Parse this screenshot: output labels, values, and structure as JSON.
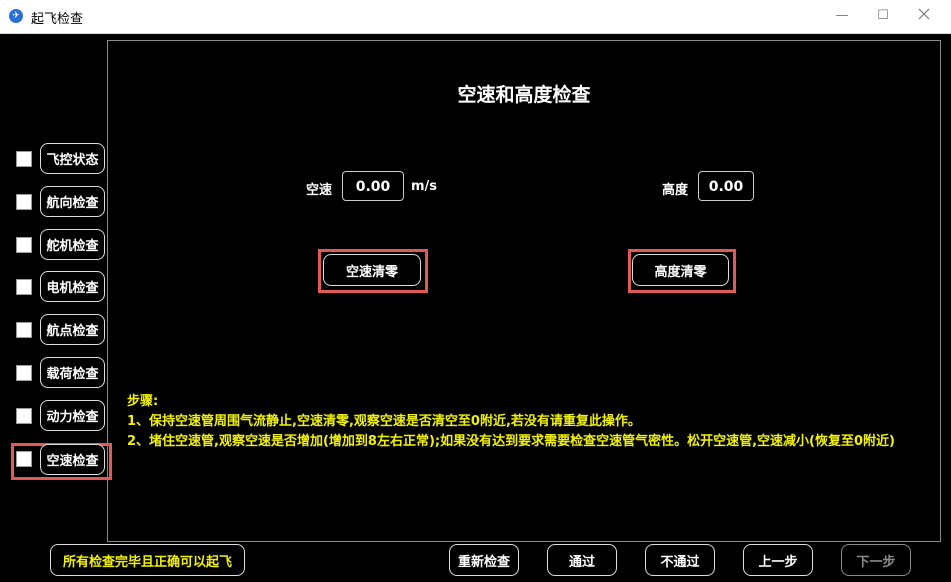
{
  "window": {
    "title": "起飞检查",
    "icon": "drone-app-icon",
    "minimize": "—",
    "maximize": "☐"
  },
  "heading": "空速和高度检查",
  "airspeed": {
    "label": "空速",
    "value": "0.00",
    "unit": "m/s",
    "zero_button": "空速清零"
  },
  "altitude": {
    "label": "高度",
    "value": "0.00",
    "zero_button": "高度清零"
  },
  "checklist": [
    {
      "label": "飞控状态",
      "checked": false
    },
    {
      "label": "航向检查",
      "checked": false
    },
    {
      "label": "舵机检查",
      "checked": false
    },
    {
      "label": "电机检查",
      "checked": false
    },
    {
      "label": "航点检查",
      "checked": false
    },
    {
      "label": "载荷检查",
      "checked": false
    },
    {
      "label": "动力检查",
      "checked": false
    },
    {
      "label": "空速检查",
      "checked": false
    }
  ],
  "steps": {
    "title": "步骤:",
    "line1": "1、保持空速管周围气流静止,空速清零,观察空速是否清空至0附近,若没有请重复此操作。",
    "line2": "2、堵住空速管,观察空速是否增加(增加到8左右正常);如果没有达到要求需要检查空速管气密性。松开空速管,空速减小(恢复至0附近)"
  },
  "footer": {
    "all_ok": "所有检查完毕且正确可以起飞",
    "recheck": "重新检查",
    "pass": "通过",
    "fail": "不通过",
    "prev": "上一步",
    "next": "下一步"
  },
  "colors": {
    "highlight": "#e05a5a",
    "steps_text": "#f2f200",
    "background": "#000000"
  }
}
